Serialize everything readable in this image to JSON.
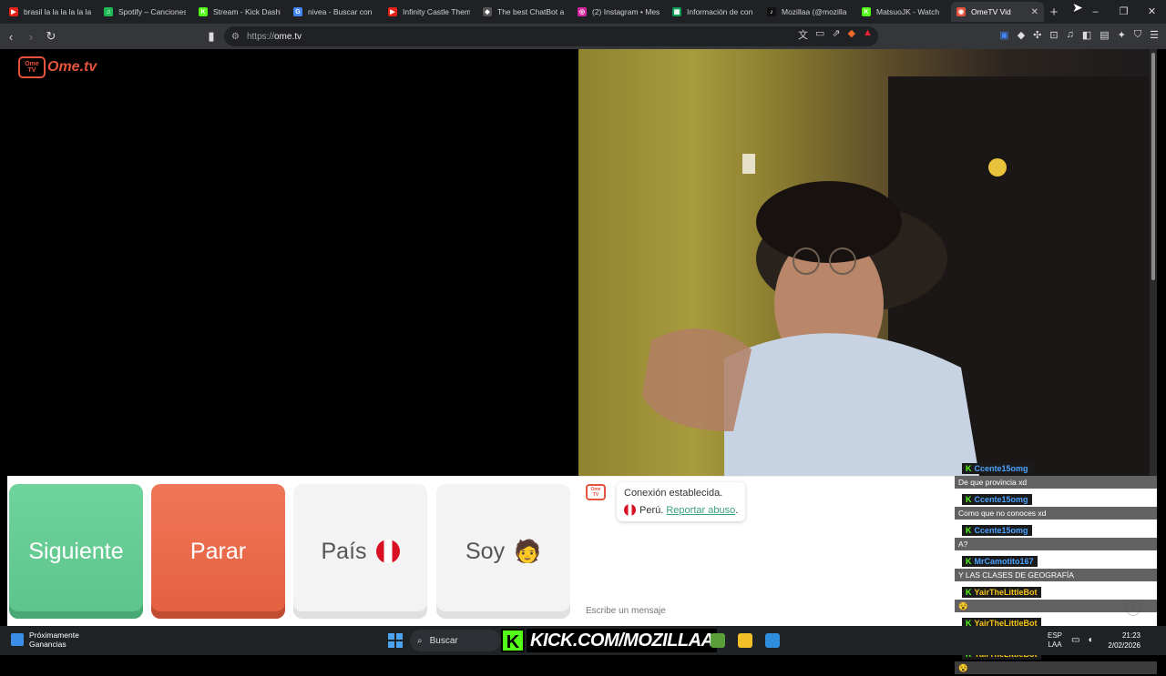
{
  "browser": {
    "tabs": [
      {
        "title": "brasil la la la la la la",
        "fav_color": "#e62117",
        "fav_glyph": "▶"
      },
      {
        "title": "Spotify – Canciones",
        "fav_color": "#1db954",
        "fav_glyph": "♫"
      },
      {
        "title": "Stream - Kick Dashb",
        "fav_color": "#53fc18",
        "fav_glyph": "K"
      },
      {
        "title": "nivea - Buscar con",
        "fav_color": "#4285f4",
        "fav_glyph": "G"
      },
      {
        "title": "Infinity Castle Them",
        "fav_color": "#e62117",
        "fav_glyph": "▶"
      },
      {
        "title": "The best ChatBot a",
        "fav_color": "#555555",
        "fav_glyph": "◆"
      },
      {
        "title": "(2) Instagram • Mes",
        "fav_color": "#d6249f",
        "fav_glyph": "◎"
      },
      {
        "title": "Información de con",
        "fav_color": "#0f9d58",
        "fav_glyph": "▦"
      },
      {
        "title": "Mozillaa (@mozilla",
        "fav_color": "#111111",
        "fav_glyph": "♪"
      },
      {
        "title": "MatsuoJK - Watch",
        "fav_color": "#53fc18",
        "fav_glyph": "K"
      },
      {
        "title": "OmeTV Vid",
        "fav_color": "#e5533d",
        "fav_glyph": "◉",
        "active": true
      }
    ],
    "url_proto": "https://",
    "url_host": "ome.tv"
  },
  "ometv": {
    "logo_text": "Ome.tv",
    "logo_badge": "Ome TV",
    "buttons": {
      "next": "Siguiente",
      "stop": "Parar",
      "country": "País",
      "gender": "Soy",
      "gender_emoji": "🧑"
    },
    "chat": {
      "connected": "Conexión establecida.",
      "country": "Perú.",
      "report": "Reportar abuso",
      "report_suffix": ".",
      "placeholder": "Escribe un mensaje"
    }
  },
  "stream_overlay": [
    {
      "user": "Ccente15omg",
      "user_color": "#4da3ff",
      "text": "De que provincia xd"
    },
    {
      "user": "Ccente15omg",
      "user_color": "#4da3ff",
      "text": "Como que no conoces xd"
    },
    {
      "user": "Ccente15omg",
      "user_color": "#4da3ff",
      "text": "A?"
    },
    {
      "user": "MrCamotito167",
      "user_color": "#4da3ff",
      "text": "Y LAS CLASES DE GEOGRAFÍA"
    },
    {
      "user": "YairTheLittleBot",
      "user_color": "#f5c518",
      "text": "😵"
    },
    {
      "user": "YairTheLittleBot",
      "user_color": "#f5c518",
      "text": "😵"
    },
    {
      "user": "YairTheLittleBot",
      "user_color": "#f5c518",
      "text": "😵"
    }
  ],
  "taskbar": {
    "weather_line1": "Próximamente",
    "weather_line2": "Ganancias",
    "search": "Buscar",
    "kick_k": "K",
    "kick_text": "KICK.COM/MOZILLAA",
    "lang1": "ESP",
    "lang2": "LAA",
    "time": "21:23",
    "date": "2/02/2026"
  }
}
